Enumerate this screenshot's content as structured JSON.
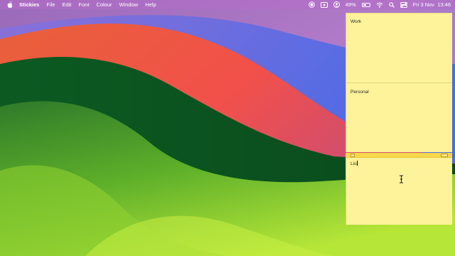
{
  "menubar": {
    "apple_icon": "apple-logo-icon",
    "app_name": "Stickies",
    "menus": [
      "File",
      "Edit",
      "Font",
      "Colour",
      "Window",
      "Help"
    ],
    "status": {
      "battery_percent": "49%",
      "battery_level": 0.49,
      "date_time": "Fri 3 Nov  13:46",
      "icons": [
        "record-icon",
        "screen-share-icon",
        "user-icon",
        "wifi-icon",
        "search-icon",
        "control-center-icon"
      ]
    }
  },
  "stickies": [
    {
      "title": "Work"
    },
    {
      "title": "Personal"
    },
    {
      "title": "Lis"
    }
  ],
  "colors": {
    "sticky_yellow": "#fef29a",
    "sticky_titlebar": "#f6d94a"
  }
}
